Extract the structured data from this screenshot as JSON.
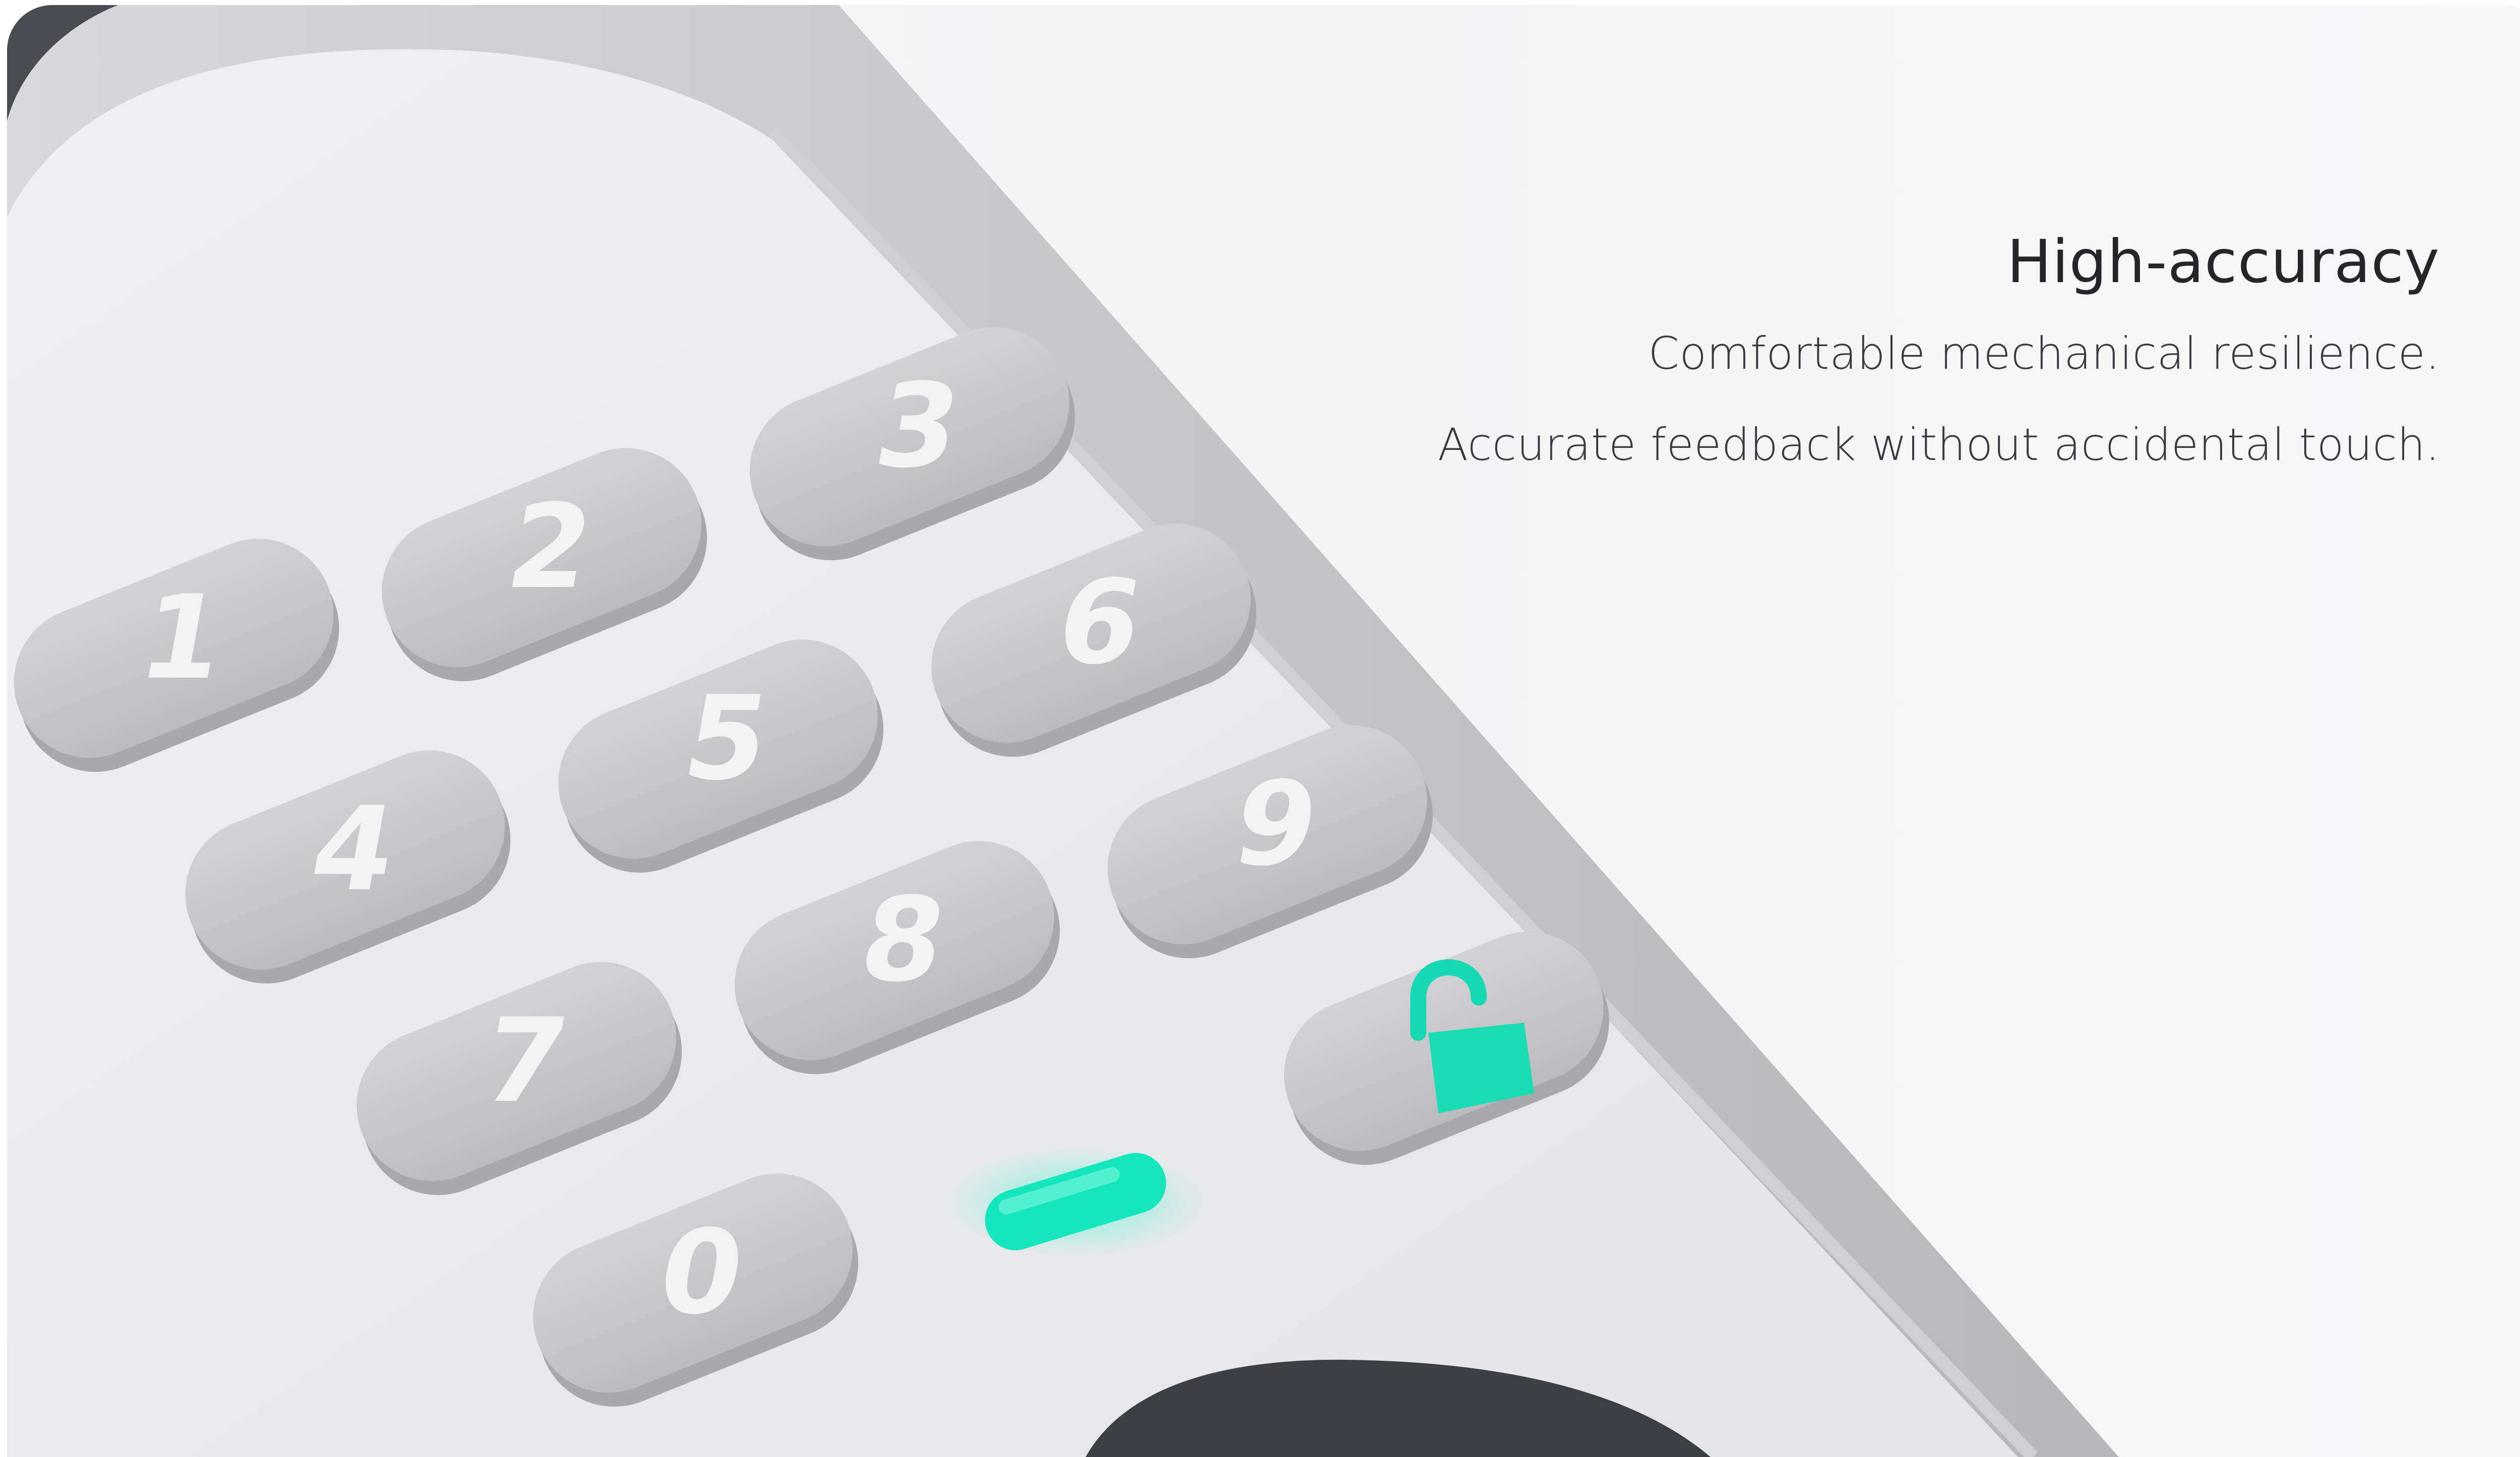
{
  "headline": "High-accuracy",
  "lines": [
    "Comfortable mechanical resilience.",
    "Accurate feedback without accidental touch."
  ],
  "keypad": {
    "keys": [
      "1",
      "2",
      "3",
      "4",
      "5",
      "6",
      "7",
      "8",
      "9",
      "0"
    ],
    "unlock_icon": "unlock-icon",
    "indicator_icon": "status-indicator-light"
  },
  "colors": {
    "background": "#f5f5f6",
    "device_body": "#ebebed",
    "key": "#c9c9cb",
    "key_label": "#f3f3f3",
    "accent": "#1de8c0",
    "text": "#2d2d30"
  }
}
